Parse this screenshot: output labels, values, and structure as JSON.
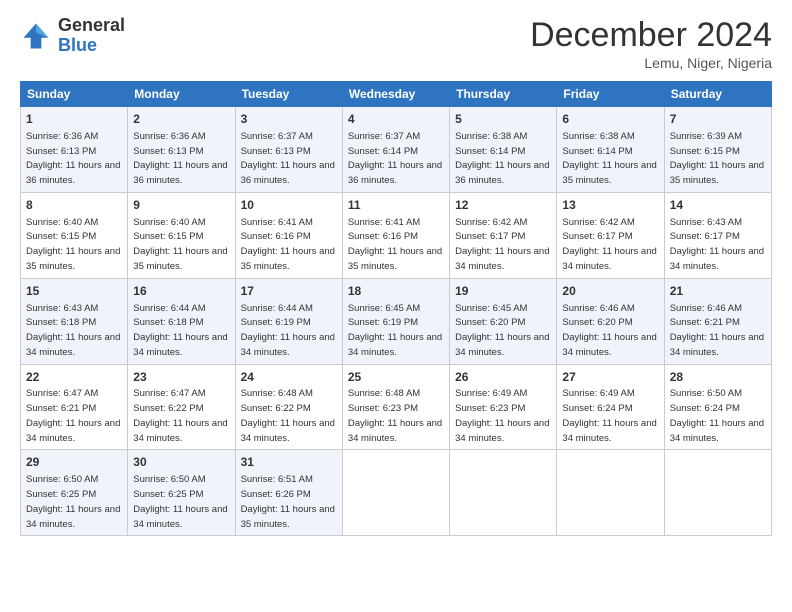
{
  "header": {
    "logo_general": "General",
    "logo_blue": "Blue",
    "title": "December 2024",
    "location": "Lemu, Niger, Nigeria"
  },
  "days_of_week": [
    "Sunday",
    "Monday",
    "Tuesday",
    "Wednesday",
    "Thursday",
    "Friday",
    "Saturday"
  ],
  "weeks": [
    [
      {
        "day": 1,
        "sunrise": "6:36 AM",
        "sunset": "6:13 PM",
        "daylight": "11 hours and 36 minutes."
      },
      {
        "day": 2,
        "sunrise": "6:36 AM",
        "sunset": "6:13 PM",
        "daylight": "11 hours and 36 minutes."
      },
      {
        "day": 3,
        "sunrise": "6:37 AM",
        "sunset": "6:13 PM",
        "daylight": "11 hours and 36 minutes."
      },
      {
        "day": 4,
        "sunrise": "6:37 AM",
        "sunset": "6:14 PM",
        "daylight": "11 hours and 36 minutes."
      },
      {
        "day": 5,
        "sunrise": "6:38 AM",
        "sunset": "6:14 PM",
        "daylight": "11 hours and 36 minutes."
      },
      {
        "day": 6,
        "sunrise": "6:38 AM",
        "sunset": "6:14 PM",
        "daylight": "11 hours and 35 minutes."
      },
      {
        "day": 7,
        "sunrise": "6:39 AM",
        "sunset": "6:15 PM",
        "daylight": "11 hours and 35 minutes."
      }
    ],
    [
      {
        "day": 8,
        "sunrise": "6:40 AM",
        "sunset": "6:15 PM",
        "daylight": "11 hours and 35 minutes."
      },
      {
        "day": 9,
        "sunrise": "6:40 AM",
        "sunset": "6:15 PM",
        "daylight": "11 hours and 35 minutes."
      },
      {
        "day": 10,
        "sunrise": "6:41 AM",
        "sunset": "6:16 PM",
        "daylight": "11 hours and 35 minutes."
      },
      {
        "day": 11,
        "sunrise": "6:41 AM",
        "sunset": "6:16 PM",
        "daylight": "11 hours and 35 minutes."
      },
      {
        "day": 12,
        "sunrise": "6:42 AM",
        "sunset": "6:17 PM",
        "daylight": "11 hours and 34 minutes."
      },
      {
        "day": 13,
        "sunrise": "6:42 AM",
        "sunset": "6:17 PM",
        "daylight": "11 hours and 34 minutes."
      },
      {
        "day": 14,
        "sunrise": "6:43 AM",
        "sunset": "6:17 PM",
        "daylight": "11 hours and 34 minutes."
      }
    ],
    [
      {
        "day": 15,
        "sunrise": "6:43 AM",
        "sunset": "6:18 PM",
        "daylight": "11 hours and 34 minutes."
      },
      {
        "day": 16,
        "sunrise": "6:44 AM",
        "sunset": "6:18 PM",
        "daylight": "11 hours and 34 minutes."
      },
      {
        "day": 17,
        "sunrise": "6:44 AM",
        "sunset": "6:19 PM",
        "daylight": "11 hours and 34 minutes."
      },
      {
        "day": 18,
        "sunrise": "6:45 AM",
        "sunset": "6:19 PM",
        "daylight": "11 hours and 34 minutes."
      },
      {
        "day": 19,
        "sunrise": "6:45 AM",
        "sunset": "6:20 PM",
        "daylight": "11 hours and 34 minutes."
      },
      {
        "day": 20,
        "sunrise": "6:46 AM",
        "sunset": "6:20 PM",
        "daylight": "11 hours and 34 minutes."
      },
      {
        "day": 21,
        "sunrise": "6:46 AM",
        "sunset": "6:21 PM",
        "daylight": "11 hours and 34 minutes."
      }
    ],
    [
      {
        "day": 22,
        "sunrise": "6:47 AM",
        "sunset": "6:21 PM",
        "daylight": "11 hours and 34 minutes."
      },
      {
        "day": 23,
        "sunrise": "6:47 AM",
        "sunset": "6:22 PM",
        "daylight": "11 hours and 34 minutes."
      },
      {
        "day": 24,
        "sunrise": "6:48 AM",
        "sunset": "6:22 PM",
        "daylight": "11 hours and 34 minutes."
      },
      {
        "day": 25,
        "sunrise": "6:48 AM",
        "sunset": "6:23 PM",
        "daylight": "11 hours and 34 minutes."
      },
      {
        "day": 26,
        "sunrise": "6:49 AM",
        "sunset": "6:23 PM",
        "daylight": "11 hours and 34 minutes."
      },
      {
        "day": 27,
        "sunrise": "6:49 AM",
        "sunset": "6:24 PM",
        "daylight": "11 hours and 34 minutes."
      },
      {
        "day": 28,
        "sunrise": "6:50 AM",
        "sunset": "6:24 PM",
        "daylight": "11 hours and 34 minutes."
      }
    ],
    [
      {
        "day": 29,
        "sunrise": "6:50 AM",
        "sunset": "6:25 PM",
        "daylight": "11 hours and 34 minutes."
      },
      {
        "day": 30,
        "sunrise": "6:50 AM",
        "sunset": "6:25 PM",
        "daylight": "11 hours and 34 minutes."
      },
      {
        "day": 31,
        "sunrise": "6:51 AM",
        "sunset": "6:26 PM",
        "daylight": "11 hours and 35 minutes."
      },
      null,
      null,
      null,
      null
    ]
  ]
}
